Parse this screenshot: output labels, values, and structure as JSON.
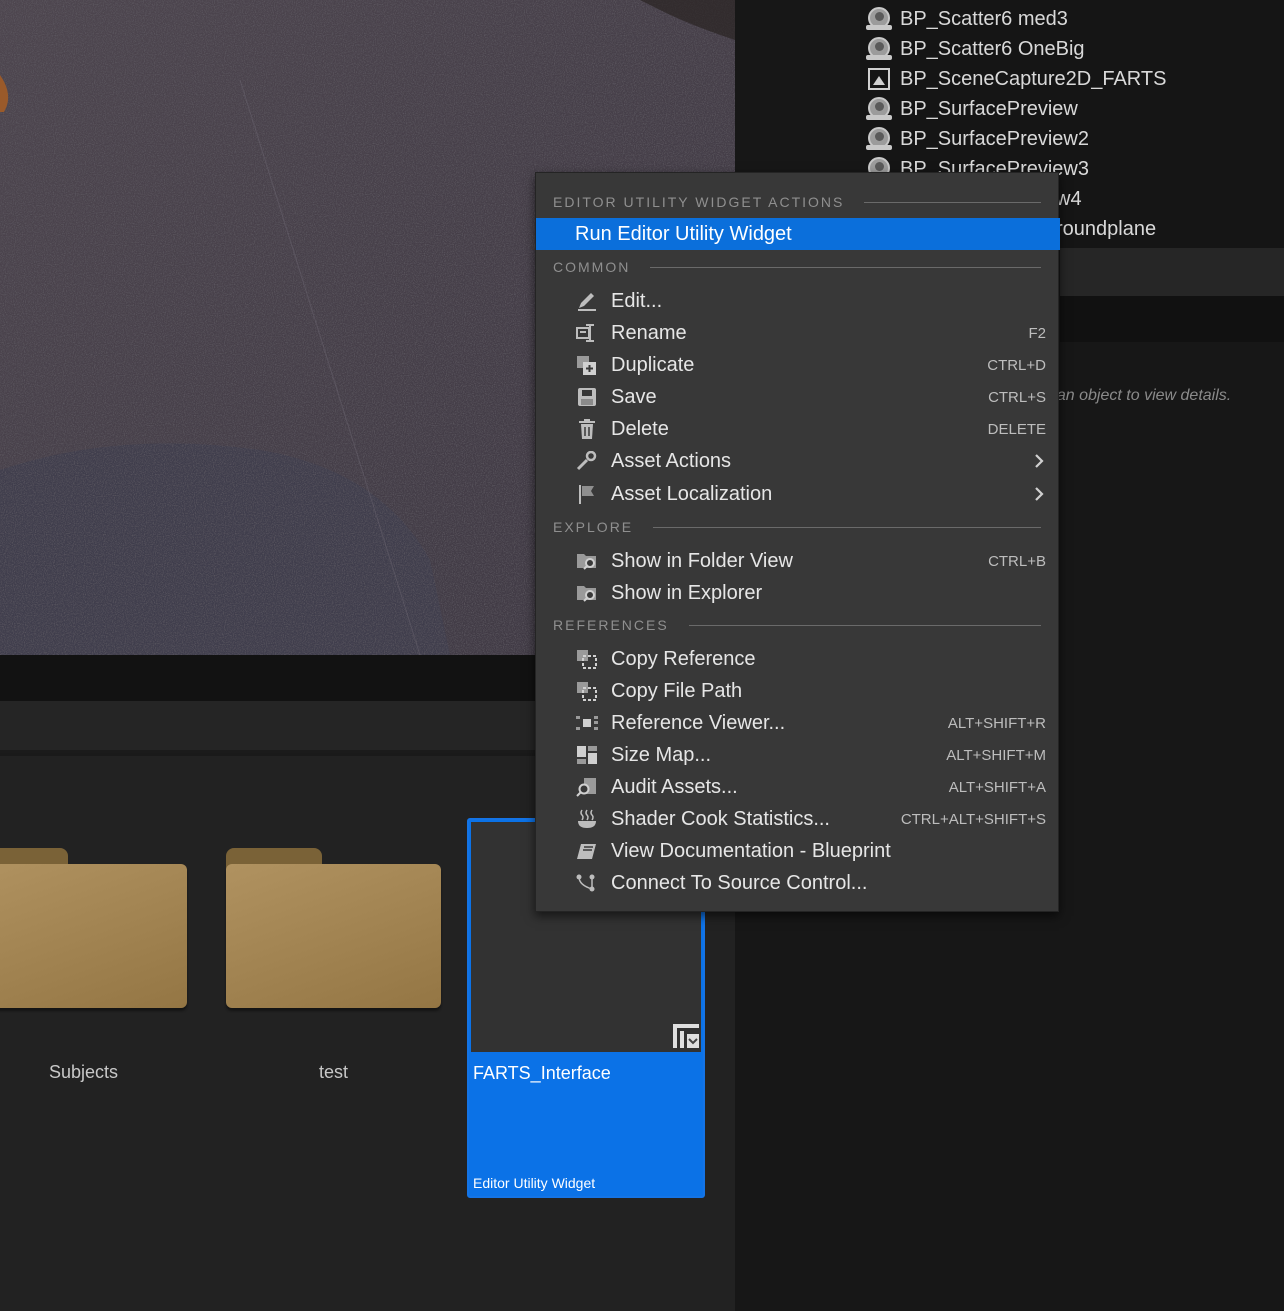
{
  "outliner": {
    "items": [
      {
        "label": "BP_Scatter6 med3",
        "icon": "blueprint-actor-icon"
      },
      {
        "label": "BP_Scatter6 OneBig",
        "icon": "blueprint-actor-icon"
      },
      {
        "label": "BP_SceneCapture2D_FARTS",
        "icon": "scene-capture-icon"
      },
      {
        "label": "BP_SurfacePreview",
        "icon": "blueprint-actor-icon"
      },
      {
        "label": "BP_SurfacePreview2",
        "icon": "blueprint-actor-icon"
      },
      {
        "label": "BP_SurfacePreview3",
        "icon": "blueprint-actor-icon"
      },
      {
        "label": "w4",
        "icon": "blueprint-actor-icon"
      },
      {
        "label": "roundplane",
        "icon": "blueprint-actor-icon"
      }
    ]
  },
  "details": {
    "hint": "t an object to view details."
  },
  "content_browser": {
    "folders": [
      {
        "label": "Subjects"
      },
      {
        "label": "test"
      }
    ],
    "asset": {
      "name": "FARTS_Interface",
      "type": "Editor Utility Widget"
    }
  },
  "context_menu": {
    "sections": {
      "widget_actions": "EDITOR UTILITY WIDGET ACTIONS",
      "common": "COMMON",
      "explore": "EXPLORE",
      "references": "REFERENCES"
    },
    "run_widget": "Run Editor Utility Widget",
    "common": [
      {
        "label": "Edit...",
        "shortcut": "",
        "icon": "edit-icon"
      },
      {
        "label": "Rename",
        "shortcut": "F2",
        "icon": "rename-icon"
      },
      {
        "label": "Duplicate",
        "shortcut": "CTRL+D",
        "icon": "duplicate-icon"
      },
      {
        "label": "Save",
        "shortcut": "CTRL+S",
        "icon": "save-icon"
      },
      {
        "label": "Delete",
        "shortcut": "DELETE",
        "icon": "trash-icon"
      },
      {
        "label": "Asset Actions",
        "shortcut": "",
        "icon": "wrench-icon"
      },
      {
        "label": "Asset Localization",
        "shortcut": "",
        "icon": "flag-icon"
      }
    ],
    "explore": [
      {
        "label": "Show in Folder View",
        "shortcut": "CTRL+B",
        "icon": "folder-search-icon"
      },
      {
        "label": "Show in Explorer",
        "shortcut": "",
        "icon": "folder-search-icon"
      }
    ],
    "references": [
      {
        "label": "Copy Reference",
        "shortcut": "",
        "icon": "copy-reference-icon"
      },
      {
        "label": "Copy File Path",
        "shortcut": "",
        "icon": "copy-path-icon"
      },
      {
        "label": "Reference Viewer...",
        "shortcut": "ALT+SHIFT+R",
        "icon": "reference-viewer-icon"
      },
      {
        "label": "Size Map...",
        "shortcut": "ALT+SHIFT+M",
        "icon": "size-map-icon"
      },
      {
        "label": "Audit Assets...",
        "shortcut": "ALT+SHIFT+A",
        "icon": "audit-icon"
      },
      {
        "label": "Shader Cook Statistics...",
        "shortcut": "CTRL+ALT+SHIFT+S",
        "icon": "shader-icon"
      },
      {
        "label": "View Documentation - Blueprint",
        "shortcut": "",
        "icon": "documentation-icon"
      },
      {
        "label": "Connect To Source Control...",
        "shortcut": "",
        "icon": "source-control-icon"
      }
    ]
  },
  "colors": {
    "accent": "#0b6fdb",
    "menu_bg": "#383838",
    "folder": "#a88a58"
  }
}
